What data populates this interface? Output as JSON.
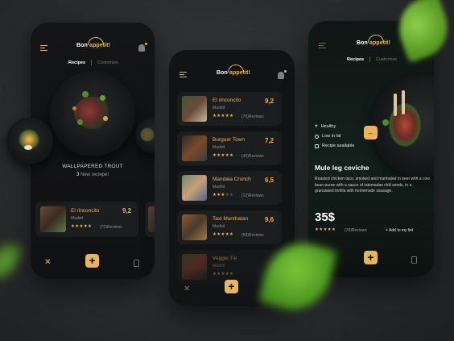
{
  "logo": {
    "part1": "Bon ",
    "part2": "appetit!"
  },
  "tabs": {
    "recipes": "Recipes",
    "customize": "Customize"
  },
  "featured": {
    "title": "WALLPAPERED TROUT",
    "count": "3",
    "count_label": "New reciepe!"
  },
  "restaurants": [
    {
      "name": "El rinconcito",
      "city": "Madrid",
      "score": "9,2",
      "rating": 5,
      "reviews": "(70)Reviews"
    },
    {
      "name": "Burguer Town",
      "city": "Madrid",
      "score": "7,2",
      "rating": 5,
      "reviews": "(46)Reviews"
    },
    {
      "name": "Mandala Crunch",
      "city": "Madrid",
      "score": "6,5",
      "rating": 3,
      "reviews": "(12)Reviews"
    },
    {
      "name": "Taxi Manthatan",
      "city": "Madrid",
      "score": "9,6",
      "rating": 5,
      "reviews": "(59)Reviews"
    },
    {
      "name": "Veggie Tie",
      "city": "Madrid",
      "score": "",
      "rating": 5,
      "reviews": ""
    }
  ],
  "detail": {
    "tags": [
      "Healthy",
      "Low in fat",
      "Recipe available"
    ],
    "title": "Mule leg ceviche",
    "description": "Roasted chicken taco, smoked and marinated in beer with a cow bean puree with a sauce of tatemadas chili seeds, in a granulated tortilla with homemade sausage.",
    "price": "35$",
    "reviews": "(70)Reviews",
    "add_label": "+ Add to my list"
  },
  "icons": {
    "plus": "+",
    "star": "★",
    "cutlery": "✕",
    "back": "←"
  },
  "colors": {
    "accent": "#e8b55a",
    "background": "#2a2b2d",
    "card": "#1c1d1f"
  }
}
